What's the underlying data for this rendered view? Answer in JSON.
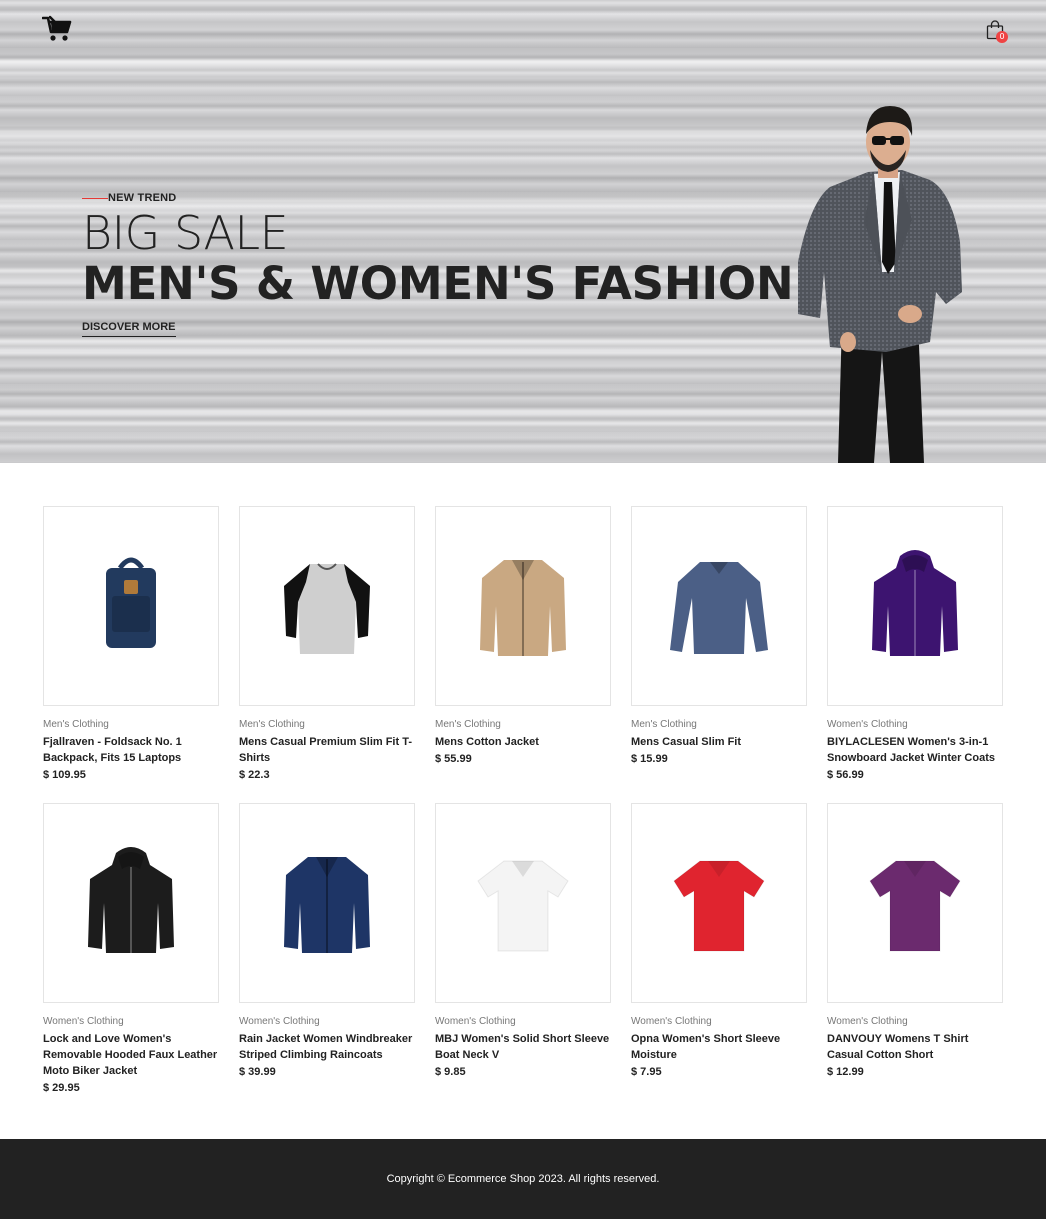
{
  "header": {
    "logo_icon": "shopping-cart-icon",
    "cart_icon": "shopping-bag-icon",
    "cart_count": "0"
  },
  "hero": {
    "eyebrow": "NEW TREND",
    "headline_light": "BIG SALE",
    "headline_bold": "MEN'S & WOMEN'S FASHION",
    "cta": "DISCOVER MORE",
    "accent_color": "#e53935"
  },
  "products": [
    {
      "category": "Men's Clothing",
      "title": "Fjallraven - Foldsack No. 1 Backpack, Fits 15 Laptops",
      "price": "$ 109.95",
      "image": "backpack",
      "color": "#223a5e"
    },
    {
      "category": "Men's Clothing",
      "title": "Mens Casual Premium Slim Fit T-Shirts",
      "price": "$ 22.3",
      "image": "raglan-shirt",
      "color": "#cfcfcf"
    },
    {
      "category": "Men's Clothing",
      "title": "Mens Cotton Jacket",
      "price": "$ 55.99",
      "image": "jacket",
      "color": "#c9a882"
    },
    {
      "category": "Men's Clothing",
      "title": "Mens Casual Slim Fit",
      "price": "$ 15.99",
      "image": "long-sleeve",
      "color": "#4b5f86"
    },
    {
      "category": "Women's Clothing",
      "title": "BIYLACLESEN Women's 3-in-1 Snowboard Jacket Winter Coats",
      "price": "$ 56.99",
      "image": "hooded-jacket",
      "color": "#3d1470"
    },
    {
      "category": "Women's Clothing",
      "title": "Lock and Love Women's Removable Hooded Faux Leather Moto Biker Jacket",
      "price": "$ 29.95",
      "image": "hooded-jacket",
      "color": "#1c1c1c"
    },
    {
      "category": "Women's Clothing",
      "title": "Rain Jacket Women Windbreaker Striped Climbing Raincoats",
      "price": "$ 39.99",
      "image": "jacket",
      "color": "#1e3566"
    },
    {
      "category": "Women's Clothing",
      "title": "MBJ Women's Solid Short Sleeve Boat Neck V",
      "price": "$ 9.85",
      "image": "tee",
      "color": "#f4f4f4"
    },
    {
      "category": "Women's Clothing",
      "title": "Opna Women's Short Sleeve Moisture",
      "price": "$ 7.95",
      "image": "tee",
      "color": "#e0242f"
    },
    {
      "category": "Women's Clothing",
      "title": "DANVOUY Womens T Shirt Casual Cotton Short",
      "price": "$ 12.99",
      "image": "tee",
      "color": "#6b2a6e"
    }
  ],
  "footer": {
    "copyright": "Copyright © Ecommerce Shop 2023. All rights reserved."
  }
}
